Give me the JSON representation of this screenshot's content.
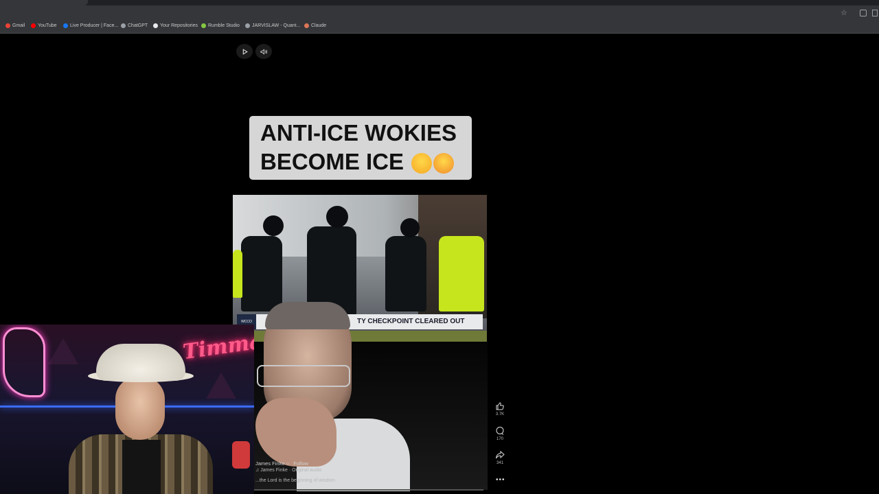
{
  "browser": {
    "bookmarks": [
      {
        "label": "Gmail",
        "color": "#ea4335"
      },
      {
        "label": "YouTube",
        "color": "#ff0000"
      },
      {
        "label": "Live Producer | Face...",
        "color": "#1877f2"
      },
      {
        "label": "ChatGPT",
        "color": "#9aa0a6"
      },
      {
        "label": "Your Repositories",
        "color": "#e8eaed"
      },
      {
        "label": "Rumble Studio",
        "color": "#85c742"
      },
      {
        "label": "JARVISLAW - Quant...",
        "color": "#9aa0a6"
      },
      {
        "label": "Claude",
        "color": "#d97757"
      }
    ]
  },
  "video": {
    "caption_line1": "ANTI-ICE WOKIES",
    "caption_line2": "BECOME ICE",
    "caption_emojis": [
      "laughing-emoji",
      "flushed-emoji"
    ],
    "ticker_logo": "WCCO",
    "ticker_text": "TY CHECKPOINT CLEARED OUT",
    "author": "James Finke",
    "follow_label": "Follow",
    "audio": "♫ James Finke · Original audio",
    "description": "...the Lord is the beginning of wisdom"
  },
  "actions": {
    "likes": "3.7K",
    "comments": "170",
    "shares": "341",
    "more": "•••"
  },
  "webcam": {
    "neon_sign": "Timmay"
  }
}
